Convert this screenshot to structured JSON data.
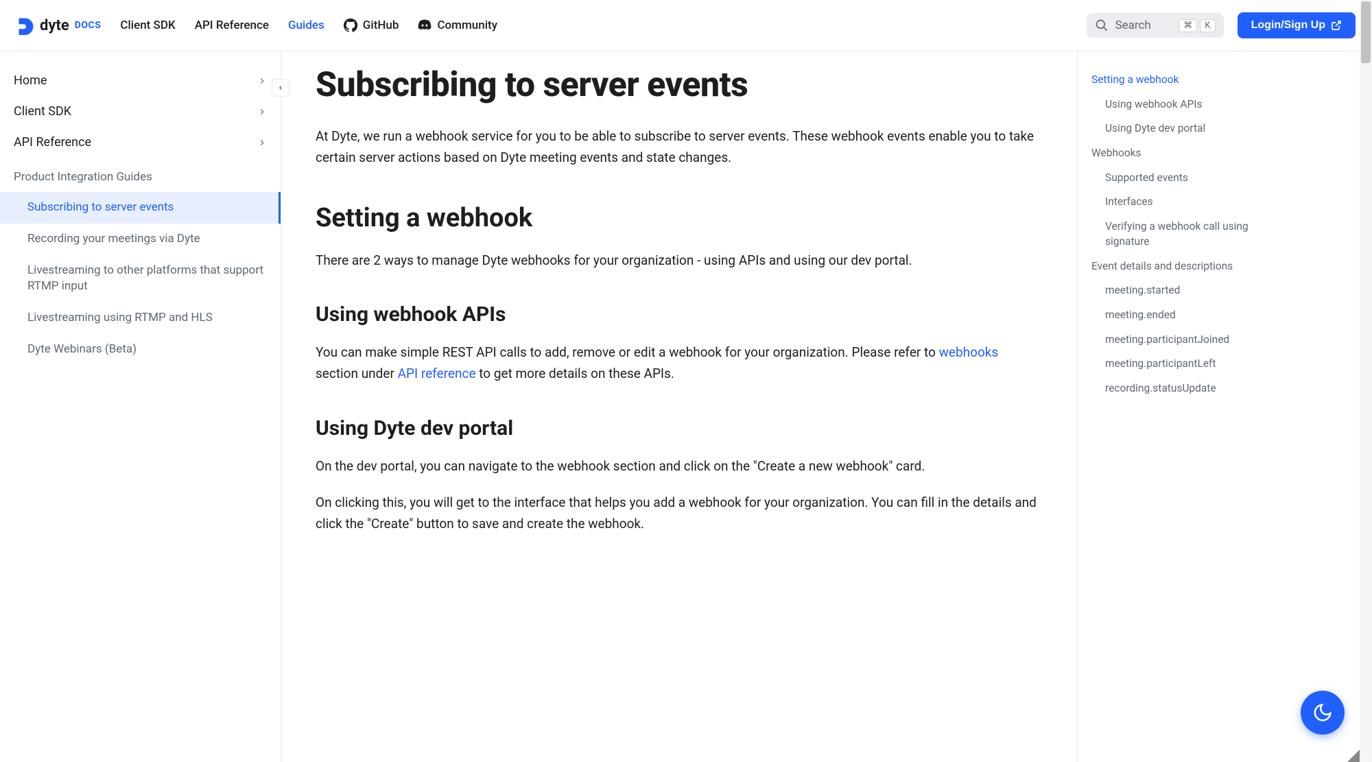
{
  "header": {
    "logo_text": "dyte",
    "logo_docs": "DOCS",
    "nav": [
      {
        "label": "Client SDK",
        "active": false
      },
      {
        "label": "API Reference",
        "active": false
      },
      {
        "label": "Guides",
        "active": true
      },
      {
        "label": "GitHub",
        "active": false,
        "icon": "github"
      },
      {
        "label": "Community",
        "active": false,
        "icon": "discord"
      }
    ],
    "search_placeholder": "Search",
    "search_key1": "⌘",
    "search_key2": "K",
    "login_label": "Login/Sign Up"
  },
  "sidebar": {
    "top_items": [
      {
        "label": "Home"
      },
      {
        "label": "Client SDK"
      },
      {
        "label": "API Reference"
      }
    ],
    "section_title": "Product Integration Guides",
    "sub_items": [
      {
        "label": "Subscribing to server events",
        "active": true
      },
      {
        "label": "Recording your meetings via Dyte",
        "active": false
      },
      {
        "label": "Livestreaming to other platforms that support RTMP input",
        "active": false
      },
      {
        "label": "Livestreaming using RTMP and HLS",
        "active": false
      },
      {
        "label": "Dyte Webinars (Beta)",
        "active": false
      }
    ]
  },
  "article": {
    "h1": "Subscribing to server events",
    "p1": "At Dyte, we run a webhook service for you to be able to subscribe to server events. These webhook events enable you to take certain server actions based on Dyte meeting events and state changes.",
    "h2_1": "Setting a webhook",
    "p2": "There are 2 ways to manage Dyte webhooks for your organization - using APIs and using our dev portal.",
    "h3_1": "Using webhook APIs",
    "p3_pre": "You can make simple REST API calls to add, remove or edit a webhook for your organization. Please refer to ",
    "p3_link1": "webhooks",
    "p3_mid": " section under ",
    "p3_link2": "API reference",
    "p3_post": " to get more details on these APIs.",
    "h3_2": "Using Dyte dev portal",
    "p4": "On the dev portal, you can navigate to the webhook section and click on the \"Create a new webhook\" card.",
    "p5": "On clicking this, you will get to the interface that helps you add a webhook for your organization. You can fill in the details and click the \"Create\" button to save and create the webhook."
  },
  "toc": [
    {
      "label": "Setting a webhook",
      "level": 1,
      "active": true
    },
    {
      "label": "Using webhook APIs",
      "level": 2,
      "active": false
    },
    {
      "label": "Using Dyte dev portal",
      "level": 2,
      "active": false
    },
    {
      "label": "Webhooks",
      "level": 1,
      "active": false
    },
    {
      "label": "Supported events",
      "level": 2,
      "active": false
    },
    {
      "label": "Interfaces",
      "level": 2,
      "active": false
    },
    {
      "label": "Verifying a webhook call using signature",
      "level": 2,
      "active": false
    },
    {
      "label": "Event details and descriptions",
      "level": 1,
      "active": false
    },
    {
      "label": "meeting.started",
      "level": 2,
      "active": false
    },
    {
      "label": "meeting.ended",
      "level": 2,
      "active": false
    },
    {
      "label": "meeting.participantJoined",
      "level": 2,
      "active": false
    },
    {
      "label": "meeting.participantLeft",
      "level": 2,
      "active": false
    },
    {
      "label": "recording.statusUpdate",
      "level": 2,
      "active": false
    }
  ]
}
